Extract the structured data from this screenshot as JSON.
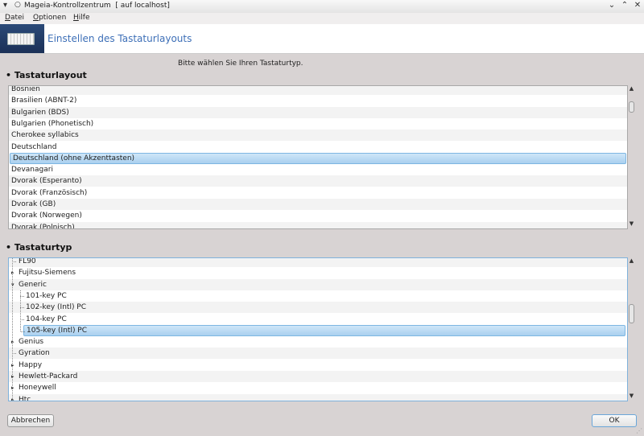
{
  "window": {
    "title": "Mageia-Kontrollzentrum  [ auf localhost]",
    "icons": {
      "menu": "chevron-down-icon",
      "pin": "pin-icon",
      "minimize": "minimize-icon",
      "maximize": "maximize-icon",
      "close": "close-icon"
    }
  },
  "menubar": [
    "Datei",
    "Optionen",
    "Hilfe"
  ],
  "banner": {
    "title": "Einstellen des Tastaturlayouts",
    "icon": "keyboard-icon"
  },
  "prompt": "Bitte wählen Sie Ihren Tastaturtyp.",
  "layout_section": {
    "title": "Tastaturlayout",
    "items": [
      "Bosnien",
      "Brasilien (ABNT-2)",
      "Bulgarien (BDS)",
      "Bulgarien (Phonetisch)",
      "Cherokee syllabics",
      "Deutschland",
      "Deutschland (ohne Akzenttasten)",
      "Devanagari",
      "Dvorak (Esperanto)",
      "Dvorak (Französisch)",
      "Dvorak (GB)",
      "Dvorak (Norwegen)",
      "Dvorak (Polnisch)"
    ],
    "selected": "Deutschland (ohne Akzenttasten)"
  },
  "type_section": {
    "title": "Tastaturtyp",
    "items": [
      {
        "label": "FL90",
        "level": 0,
        "expander": "none"
      },
      {
        "label": "Fujitsu-Siemens",
        "level": 0,
        "expander": "collapsed"
      },
      {
        "label": "Generic",
        "level": 0,
        "expander": "expanded"
      },
      {
        "label": "101-key PC",
        "level": 1,
        "expander": "none"
      },
      {
        "label": "102-key (Intl) PC",
        "level": 1,
        "expander": "none"
      },
      {
        "label": "104-key PC",
        "level": 1,
        "expander": "none"
      },
      {
        "label": "105-key (Intl) PC",
        "level": 1,
        "expander": "none"
      },
      {
        "label": "Genius",
        "level": 0,
        "expander": "collapsed"
      },
      {
        "label": "Gyration",
        "level": 0,
        "expander": "none"
      },
      {
        "label": "Happy",
        "level": 0,
        "expander": "collapsed"
      },
      {
        "label": "Hewlett-Packard",
        "level": 0,
        "expander": "collapsed"
      },
      {
        "label": "Honeywell",
        "level": 0,
        "expander": "collapsed"
      },
      {
        "label": "Htc",
        "level": 0,
        "expander": "collapsed"
      }
    ],
    "selected": "105-key (Intl) PC"
  },
  "buttons": {
    "cancel": "Abbrechen",
    "ok": "OK"
  }
}
